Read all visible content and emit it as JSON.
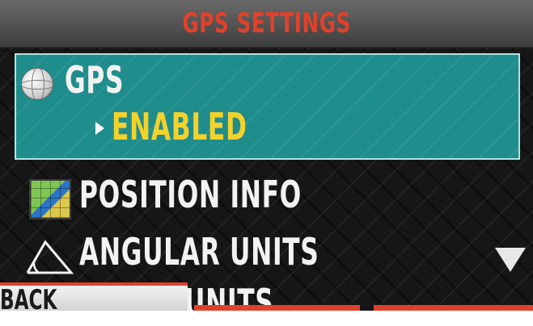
{
  "header": {
    "title": "GPS SETTINGS"
  },
  "menu": {
    "items": [
      {
        "label": "GPS",
        "value": "ENABLED",
        "selected": true,
        "icon": "globe-icon"
      },
      {
        "label": "POSITION INFO",
        "icon": "map-icon"
      },
      {
        "label": "ANGULAR UNITS",
        "icon": "angle-icon"
      },
      {
        "label": "UNITS",
        "icon": ""
      }
    ]
  },
  "footer": {
    "back_label": "BACK"
  },
  "scroll_indicator": "scroll-down-arrow-icon",
  "colors": {
    "accent": "#e0412a",
    "selected_bg": "#1f8d8c",
    "value_text": "#f4d22c",
    "text": "#f2f2f2"
  }
}
